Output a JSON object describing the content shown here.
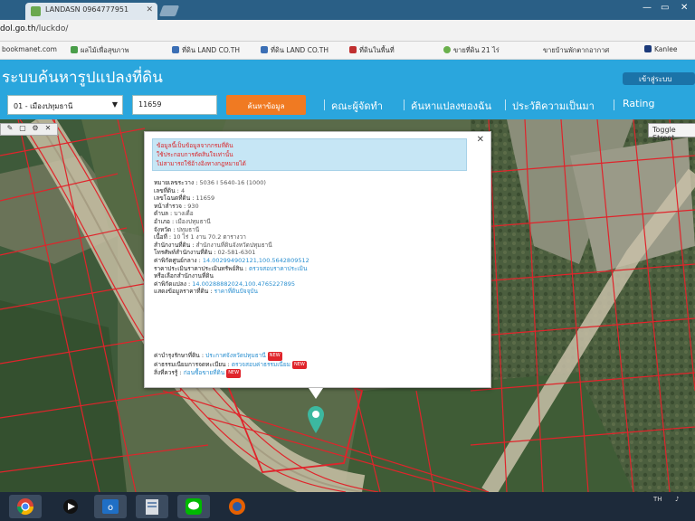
{
  "browser": {
    "tabs": [
      {
        "title": "LANDASN 0964777951",
        "active": true
      },
      {
        "title": "",
        "active": false
      }
    ],
    "url_host": "dol.go.th",
    "url_path": "/luckdo/",
    "bookmarks": [
      "bookmanet.com",
      "ผลไม้เพื่อสุขภาพ",
      "ที่ดิน LAND CO.TH",
      "ที่ดิน LAND CO.TH",
      "ที่ดินในพื้นที่",
      "ขายที่ดิน 21 ไร่",
      "ขายบ้านพักตากอากาศ",
      "Kanlee"
    ]
  },
  "app": {
    "title": "ระบบค้นหารูปแปลงที่ดิน",
    "user_button": "เข้าสู่ระบบ",
    "province_select": "01 - เมืองปทุมธานี",
    "parcel_input": "11659",
    "search_button": "ค้นหาข้อมูล",
    "nav": [
      "คณะผู้จัดทำ",
      "ค้นหาแปลงของฉัน",
      "ประวัติความเป็นมา",
      "Rating"
    ],
    "toggle_label": "Toggle Street"
  },
  "popup": {
    "warning_lines": [
      "ข้อมูลนี้เป็นข้อมูลจากกรมที่ดิน",
      "ใช้ประกอบการตัดสินใจเท่านั้น",
      "ไม่สามารถใช้อ้างอิงทางกฎหมายได้"
    ],
    "fields": [
      {
        "label": "หมายเลขระวาง",
        "value": "5036 I 5640-16 (1000)"
      },
      {
        "label": "เลขที่ดิน",
        "value": "4"
      },
      {
        "label": "เลขโฉนดที่ดิน",
        "value": "11659"
      },
      {
        "label": "หน้าสำรวจ",
        "value": "930"
      },
      {
        "label": "ตำบล",
        "value": "บางเดื่อ"
      },
      {
        "label": "อำเภอ",
        "value": "เมืองปทุมธานี"
      },
      {
        "label": "จังหวัด",
        "value": "ปทุมธานี"
      },
      {
        "label": "เนื้อที่",
        "value": "10 ไร่ 1 งาน 70.2 ตารางวา"
      },
      {
        "label": "สำนักงานที่ดิน",
        "value": "สำนักงานที่ดินจังหวัดปทุมธานี"
      },
      {
        "label": "โทรศัพท์สำนักงานที่ดิน",
        "value": "02-581-6301"
      },
      {
        "label": "ค่าพิกัดศูนย์กลาง",
        "value": "14.002994902121,100.5642809512"
      },
      {
        "label": "ราคาประเมินราคาประเมินทรัพย์สิน",
        "value": "ตรวจสอบราคาประเมิน"
      },
      {
        "label": "หรือเลือกสำนักงานที่ดิน",
        "value": ""
      },
      {
        "label": "ค่าพิกัดแปลง",
        "value": "14.00288882024,100.4765227895"
      },
      {
        "label": "แสดงข้อมูลราคาที่ดิน",
        "value": "ราคาที่ดินปัจจุบัน"
      }
    ],
    "links": [
      {
        "label": "ค่าบำรุงรักษาที่ดิน",
        "text": "ประกาศจังหวัดปทุมธานี",
        "badge": "NEW"
      },
      {
        "label": "ค่าธรรมเนียมการจดทะเบียน",
        "text": "ตรวจสอบค่าธรรมเนียม",
        "badge": "NEW"
      },
      {
        "label": "สิ่งที่ควรรู้",
        "text": "ก่อนซื้อขายที่ดิน",
        "badge": "NEW"
      }
    ]
  },
  "taskbar": {
    "apps": [
      "chrome-icon",
      "media-icon",
      "outlook-icon",
      "files-icon",
      "line-icon",
      "firefox-icon"
    ],
    "tray_text": "TH"
  },
  "colors": {
    "header": "#2aa6dd",
    "orange": "#f07a22",
    "parcel_line": "#e0242b"
  }
}
